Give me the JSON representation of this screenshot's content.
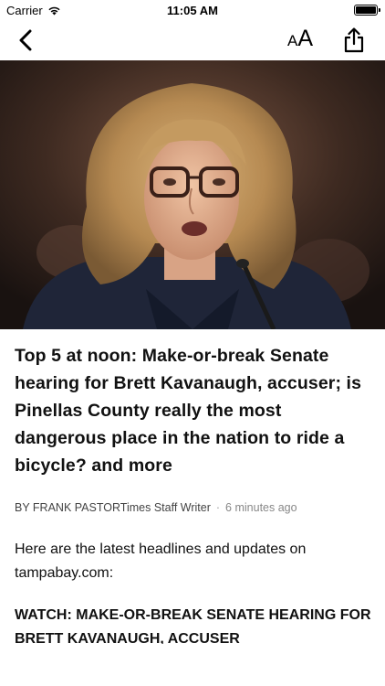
{
  "status_bar": {
    "carrier": "Carrier",
    "time": "11:05 AM"
  },
  "nav": {
    "font_small": "A",
    "font_large": "A"
  },
  "article": {
    "headline": "Top 5 at noon: Make-or-break Senate hearing for Brett Kavanaugh, accuser; is Pinellas County really the most dangerous place in the nation to ride a bicycle? and more",
    "byline": "BY FRANK PASTORTimes Staff Writer",
    "separator": "·",
    "timestamp": "6 minutes ago",
    "intro": "Here are the latest headlines and updates on tampabay.com:",
    "subhead": "WATCH: MAKE-OR-BREAK SENATE HEARING FOR BRETT KAVANAUGH, ACCUSER"
  }
}
